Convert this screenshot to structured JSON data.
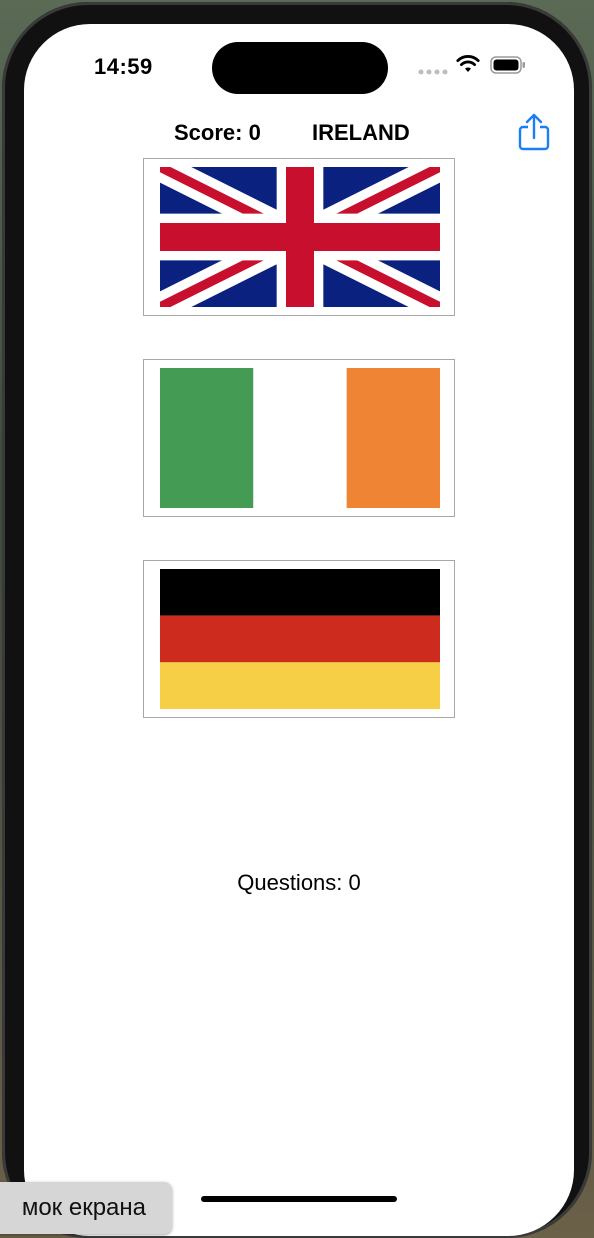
{
  "status_bar": {
    "time": "14:59",
    "icons": [
      "cellular-signal-icon",
      "wifi-icon",
      "battery-icon"
    ]
  },
  "header": {
    "score_text": "Score: 0",
    "country_text": "IRELAND",
    "share_icon": "share-icon"
  },
  "flags": [
    {
      "country": "United Kingdom",
      "icon": "uk-flag-image"
    },
    {
      "country": "Ireland",
      "icon": "ireland-flag-image"
    },
    {
      "country": "Germany",
      "icon": "germany-flag-image"
    }
  ],
  "footer": {
    "questions_text": "Questions: 0"
  },
  "tooltip": {
    "text": "мок екрана"
  },
  "colors": {
    "accent": "#1a7ef5",
    "uk_blue": "#0a2180",
    "uk_red": "#c8102e",
    "ireland_green": "#169b62",
    "ireland_orange": "#ff883e",
    "germany_black": "#000000",
    "germany_red": "#dd0000",
    "germany_gold": "#ffce00"
  }
}
